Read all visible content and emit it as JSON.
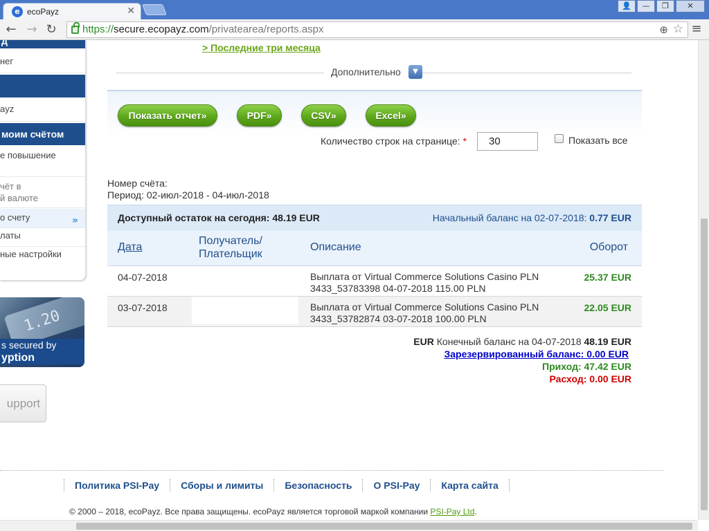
{
  "browser": {
    "tab_title": "ecoPayz",
    "tab_favicon": "e",
    "close_glyph": "✕",
    "back_glyph": "←",
    "forward_glyph": "→",
    "reload_glyph": "↻",
    "zoom_glyph": "⊕",
    "star_glyph": "☆",
    "menu_glyph": "≡",
    "url_scheme": "https://",
    "url_host": "secure.ecopayz.com",
    "url_path": "/privatearea/reports.aspx",
    "window_buttons": [
      "👤",
      "—",
      "❐",
      "✕"
    ]
  },
  "sidebar": {
    "items": [
      {
        "text": "д",
        "kind": "head"
      },
      {
        "text": "нег",
        "kind": "item"
      },
      {
        "text": "",
        "kind": "head"
      },
      {
        "text": "ayz",
        "kind": "item"
      },
      {
        "text": "моим счётом",
        "kind": "head"
      },
      {
        "text": "е повышение",
        "kind": "item"
      },
      {
        "text": "чёт в\nй валюте",
        "kind": "item"
      },
      {
        "text": "о счету",
        "kind": "item-active"
      },
      {
        "text": "латы",
        "kind": "item"
      },
      {
        "text": "ные настройки",
        "kind": "item"
      }
    ],
    "active_chevron": "»",
    "banner_card_text": "1.20",
    "banner_line1": "s secured by",
    "banner_line2": "yption",
    "support_label": "upport"
  },
  "filters": {
    "last_three_months": "> Последние три месяца",
    "more_label": "Дополнительно",
    "more_icon_glyph": "▼"
  },
  "actions": {
    "show_report": "Показать отчет»",
    "pdf": "PDF»",
    "csv": "CSV»",
    "excel": "Excel»"
  },
  "paging": {
    "rows_label": "Количество строк на странице:",
    "required_mark": "*",
    "rows_value": "30",
    "show_all_label": "Показать все",
    "show_all_checked": false
  },
  "account": {
    "number_label": "Номер счёта:",
    "period": "Период: 02-июл-2018 - 04-июл-2018"
  },
  "balance": {
    "available_label": "Доступный остаток на сегодня: 48.19 EUR",
    "opening_label": "Начальный баланс на 02-07-2018:",
    "opening_value": "0.77 EUR"
  },
  "table": {
    "headers": {
      "date": "Дата",
      "payee_line1": "Получатель/",
      "payee_line2": "Плательщик",
      "description": "Описание",
      "amount": "Оборот"
    },
    "rows": [
      {
        "date": "04-07-2018",
        "payee": "",
        "description_line1": "Выплата от Virtual Commerce Solutions Casino PLN",
        "description_line2": "3433_53783398 04-07-2018 115.00 PLN",
        "amount": "25.37 EUR"
      },
      {
        "date": "03-07-2018",
        "payee": "",
        "description_line1": "Выплата от Virtual Commerce Solutions Casino PLN",
        "description_line2": "3433_53782874 03-07-2018 100.00 PLN",
        "amount": "22.05 EUR"
      }
    ]
  },
  "summary": {
    "currency": "EUR",
    "final_label": "Конечный баланс на 04-07-2018",
    "final_value": "48.19 EUR",
    "reserved": "Зарезервированный баланс: 0.00 EUR",
    "income": "Приход: 47.42 EUR",
    "expense": "Расход: 0.00 EUR"
  },
  "footer": {
    "links": [
      "Политика PSI-Pay",
      "Сборы и лимиты",
      "Безопасность",
      "О PSI-Pay",
      "Карта сайта"
    ],
    "copyright_text": "© 2000 – 2018, ecoPayz. Все права защищены. ecoPayz является торговой маркой компании",
    "copyright_link": "PSI-Pay Ltd",
    "copyright_end": "."
  },
  "colors": {
    "brand_blue": "#1e4f8c",
    "button_green": "#5ea91b",
    "amount_green": "#2d8a1e",
    "expense_red": "#d00000",
    "link_green": "#6aa516"
  }
}
